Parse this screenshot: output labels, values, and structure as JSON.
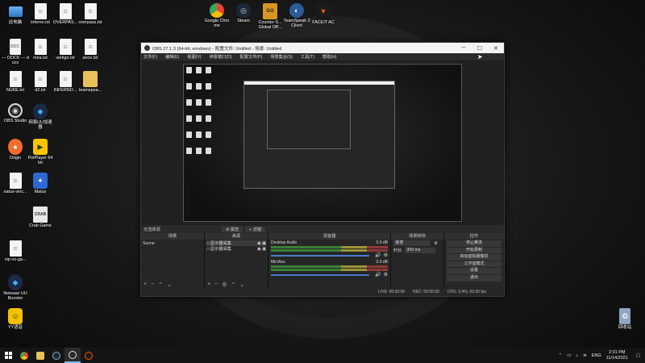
{
  "desktop": {
    "left_icons": [
      {
        "label": "此电脑",
        "icon": "pc-icon"
      },
      {
        "label": "inferno.txt",
        "icon": "text-file-icon"
      },
      {
        "label": "OVERPAS...",
        "icon": "text-file-icon"
      },
      {
        "label": "overpass.txt",
        "icon": "text-file-icon"
      },
      {
        "label": "--- DOCK\n--- docx",
        "icon": "docx-file-icon"
      },
      {
        "label": "mira.txt",
        "icon": "text-file-icon"
      },
      {
        "label": "vertigo.txt",
        "icon": "text-file-icon"
      },
      {
        "label": "ance.txt",
        "icon": "text-file-icon"
      },
      {
        "label": "NUKE.txt",
        "icon": "text-file-icon"
      },
      {
        "label": "d2.txt",
        "icon": "text-file-icon"
      },
      {
        "label": "INFERNO...",
        "icon": "text-file-icon"
      },
      {
        "label": "teamspea...",
        "icon": "folder-icon"
      },
      {
        "label": "OBS Studio",
        "icon": "obs-icon"
      },
      {
        "label": "网易UU加速器",
        "icon": "uu-icon"
      },
      {
        "label": "Origin",
        "icon": "origin-icon"
      },
      {
        "label": "PotPlayer 64 bit",
        "icon": "potplayer-icon"
      },
      {
        "label": "natus-vinc...",
        "icon": "text-file-icon"
      },
      {
        "label": "Malus",
        "icon": "malus-icon"
      },
      {
        "label": "Crab Game",
        "icon": "crab-game-icon"
      },
      {
        "label": "nip-vs-ga...",
        "icon": "text-file-icon"
      },
      {
        "label": "Netease UU Booster",
        "icon": "netease-icon"
      },
      {
        "label": "YY语音",
        "icon": "yy-icon"
      }
    ],
    "top_icons": [
      {
        "label": "Google Chrome",
        "icon": "chrome-icon"
      },
      {
        "label": "Steam",
        "icon": "steam-icon"
      },
      {
        "label": "Counter-S... Global Off...",
        "icon": "csgo-icon"
      },
      {
        "label": "TeamSpeak 3 Client",
        "icon": "teamspeak-icon"
      },
      {
        "label": "FACEIT AC",
        "icon": "faceit-icon"
      }
    ],
    "recycle_bin": {
      "label": "回收站"
    }
  },
  "obs": {
    "title": "OBS 27.1.3 (64-bit, windows) - 配置文件: Untitled - 场景: Untitled",
    "menu": [
      "文件(F)",
      "编辑(E)",
      "视图(V)",
      "停靠窗口(D)",
      "配置文件(P)",
      "场景集合(S)",
      "工具(T)",
      "帮助(H)"
    ],
    "status_row": {
      "label": "无选择源",
      "properties": "属性",
      "filters": "滤镜"
    },
    "docks": {
      "scenes": {
        "header": "场景",
        "items": [
          "Scene"
        ]
      },
      "sources": {
        "header": "来源",
        "items": [
          "显示器采集",
          "显示器采集"
        ]
      },
      "mixer": {
        "header": "混音器",
        "tracks": [
          {
            "name": "Desktop Audio",
            "level": "0.0 dB"
          },
          {
            "name": "Mic/Aux",
            "level": "0.0 dB"
          }
        ]
      },
      "transitions": {
        "header": "场景转场",
        "type": "渐变",
        "duration_label": "时长",
        "duration": "300 ms"
      },
      "controls": {
        "header": "控件",
        "buttons": [
          "停止推流",
          "开始录制",
          "启动虚拟摄像机",
          "工作室模式",
          "设置",
          "退出"
        ]
      }
    },
    "statusbar": {
      "live": "LIVE: 00:00:00",
      "rec": "REC: 00:00:00",
      "cpu": "CPU: 3.4%, 60.00 fps"
    }
  },
  "taskbar": {
    "lang": "ENG",
    "time": "2:01 PM",
    "date": "11/14/2021"
  }
}
